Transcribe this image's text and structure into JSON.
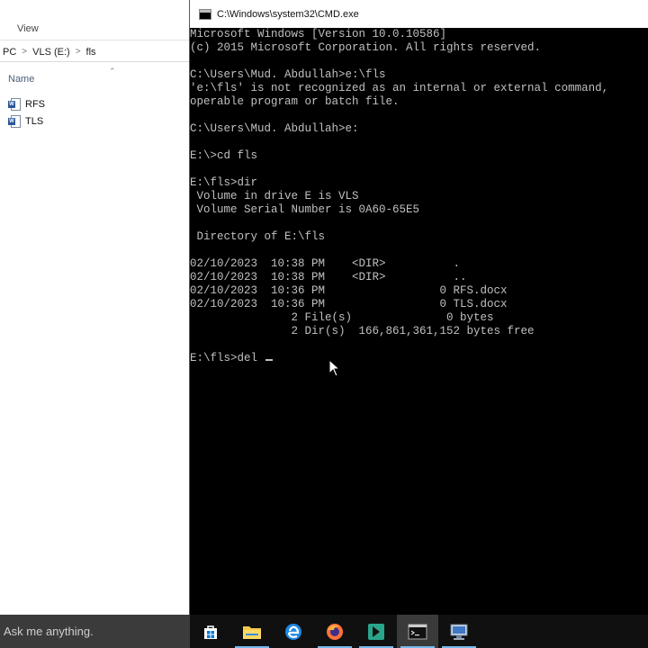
{
  "explorer": {
    "ribbon_tab": "View",
    "breadcrumb": [
      "PC",
      "VLS (E:)",
      "fls"
    ],
    "column_name": "Name",
    "files": [
      {
        "name": "RFS",
        "icon": "word-doc-icon"
      },
      {
        "name": "TLS",
        "icon": "word-doc-icon"
      }
    ]
  },
  "cmd": {
    "title": "C:\\Windows\\system32\\CMD.exe",
    "lines": [
      "Microsoft Windows [Version 10.0.10586]",
      "(c) 2015 Microsoft Corporation. All rights reserved.",
      "",
      "C:\\Users\\Mud. Abdullah>e:\\fls",
      "'e:\\fls' is not recognized as an internal or external command,",
      "operable program or batch file.",
      "",
      "C:\\Users\\Mud. Abdullah>e:",
      "",
      "E:\\>cd fls",
      "",
      "E:\\fls>dir",
      " Volume in drive E is VLS",
      " Volume Serial Number is 0A60-65E5",
      "",
      " Directory of E:\\fls",
      "",
      "02/10/2023  10:38 PM    <DIR>          .",
      "02/10/2023  10:38 PM    <DIR>          ..",
      "02/10/2023  10:36 PM                 0 RFS.docx",
      "02/10/2023  10:36 PM                 0 TLS.docx",
      "               2 File(s)              0 bytes",
      "               2 Dir(s)  166,861,361,152 bytes free",
      ""
    ],
    "current_prompt": "E:\\fls>del "
  },
  "taskbar": {
    "search_placeholder": "Ask me anything.",
    "buttons": [
      "store-icon",
      "file-explorer-icon",
      "edge-icon",
      "firefox-icon",
      "app-icon",
      "command-prompt-icon",
      "remote-desktop-icon"
    ]
  },
  "colors": {
    "console_bg": "#000000",
    "console_text": "#c0c0c0",
    "taskbar_bg": "#101010",
    "accent": "#76b9ed"
  }
}
